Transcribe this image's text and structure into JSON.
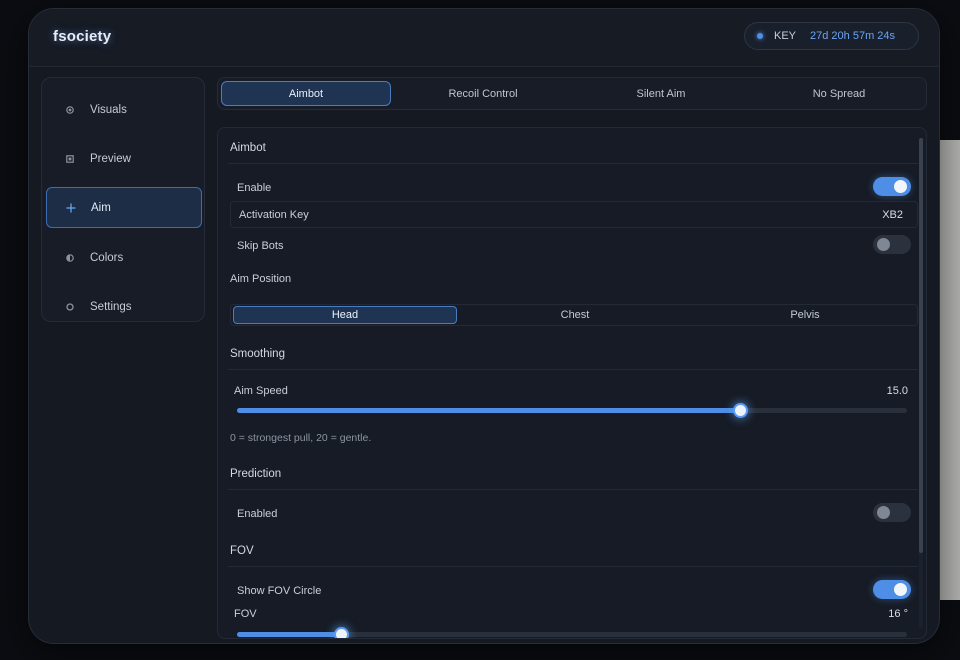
{
  "app": {
    "title": "fsociety"
  },
  "license": {
    "label": "KEY",
    "time_remaining": "27d 20h 57m 24s"
  },
  "sidebar": {
    "items": [
      {
        "label": "Visuals",
        "icon": "circle-dot-icon",
        "active": false
      },
      {
        "label": "Preview",
        "icon": "square-icon",
        "active": false
      },
      {
        "label": "Aim",
        "icon": "crosshair-plus-icon",
        "active": true
      },
      {
        "label": "Colors",
        "icon": "half-circle-icon",
        "active": false
      },
      {
        "label": "Settings",
        "icon": "gear-icon",
        "active": false
      }
    ]
  },
  "tabs": [
    {
      "label": "Aimbot",
      "active": true
    },
    {
      "label": "Recoil Control",
      "active": false
    },
    {
      "label": "Silent Aim",
      "active": false
    },
    {
      "label": "No Spread",
      "active": false
    }
  ],
  "aimbot": {
    "section_title": "Aimbot",
    "enable": {
      "label": "Enable",
      "on": true
    },
    "activation_key": {
      "label": "Activation Key",
      "value": "XB2"
    },
    "skip_bots": {
      "label": "Skip Bots",
      "on": false
    },
    "aim_position": {
      "label": "Aim Position",
      "options": [
        "Head",
        "Chest",
        "Pelvis"
      ],
      "selected": "Head"
    }
  },
  "smoothing": {
    "section_title": "Smoothing",
    "aim_speed": {
      "label": "Aim Speed",
      "value": "15.0",
      "min": 0,
      "max": 20,
      "current": 15
    },
    "hint": "0 = strongest pull, 20 = gentle."
  },
  "prediction": {
    "section_title": "Prediction",
    "enabled": {
      "label": "Enabled",
      "on": false
    }
  },
  "fov": {
    "section_title": "FOV",
    "show_circle": {
      "label": "Show FOV Circle",
      "on": true
    },
    "fov_slider": {
      "label": "FOV",
      "value": "16 °",
      "fraction": 0.155
    }
  },
  "colors": {
    "accent": "#4e8ee6",
    "panel": "#161b25",
    "window": "#141922"
  }
}
